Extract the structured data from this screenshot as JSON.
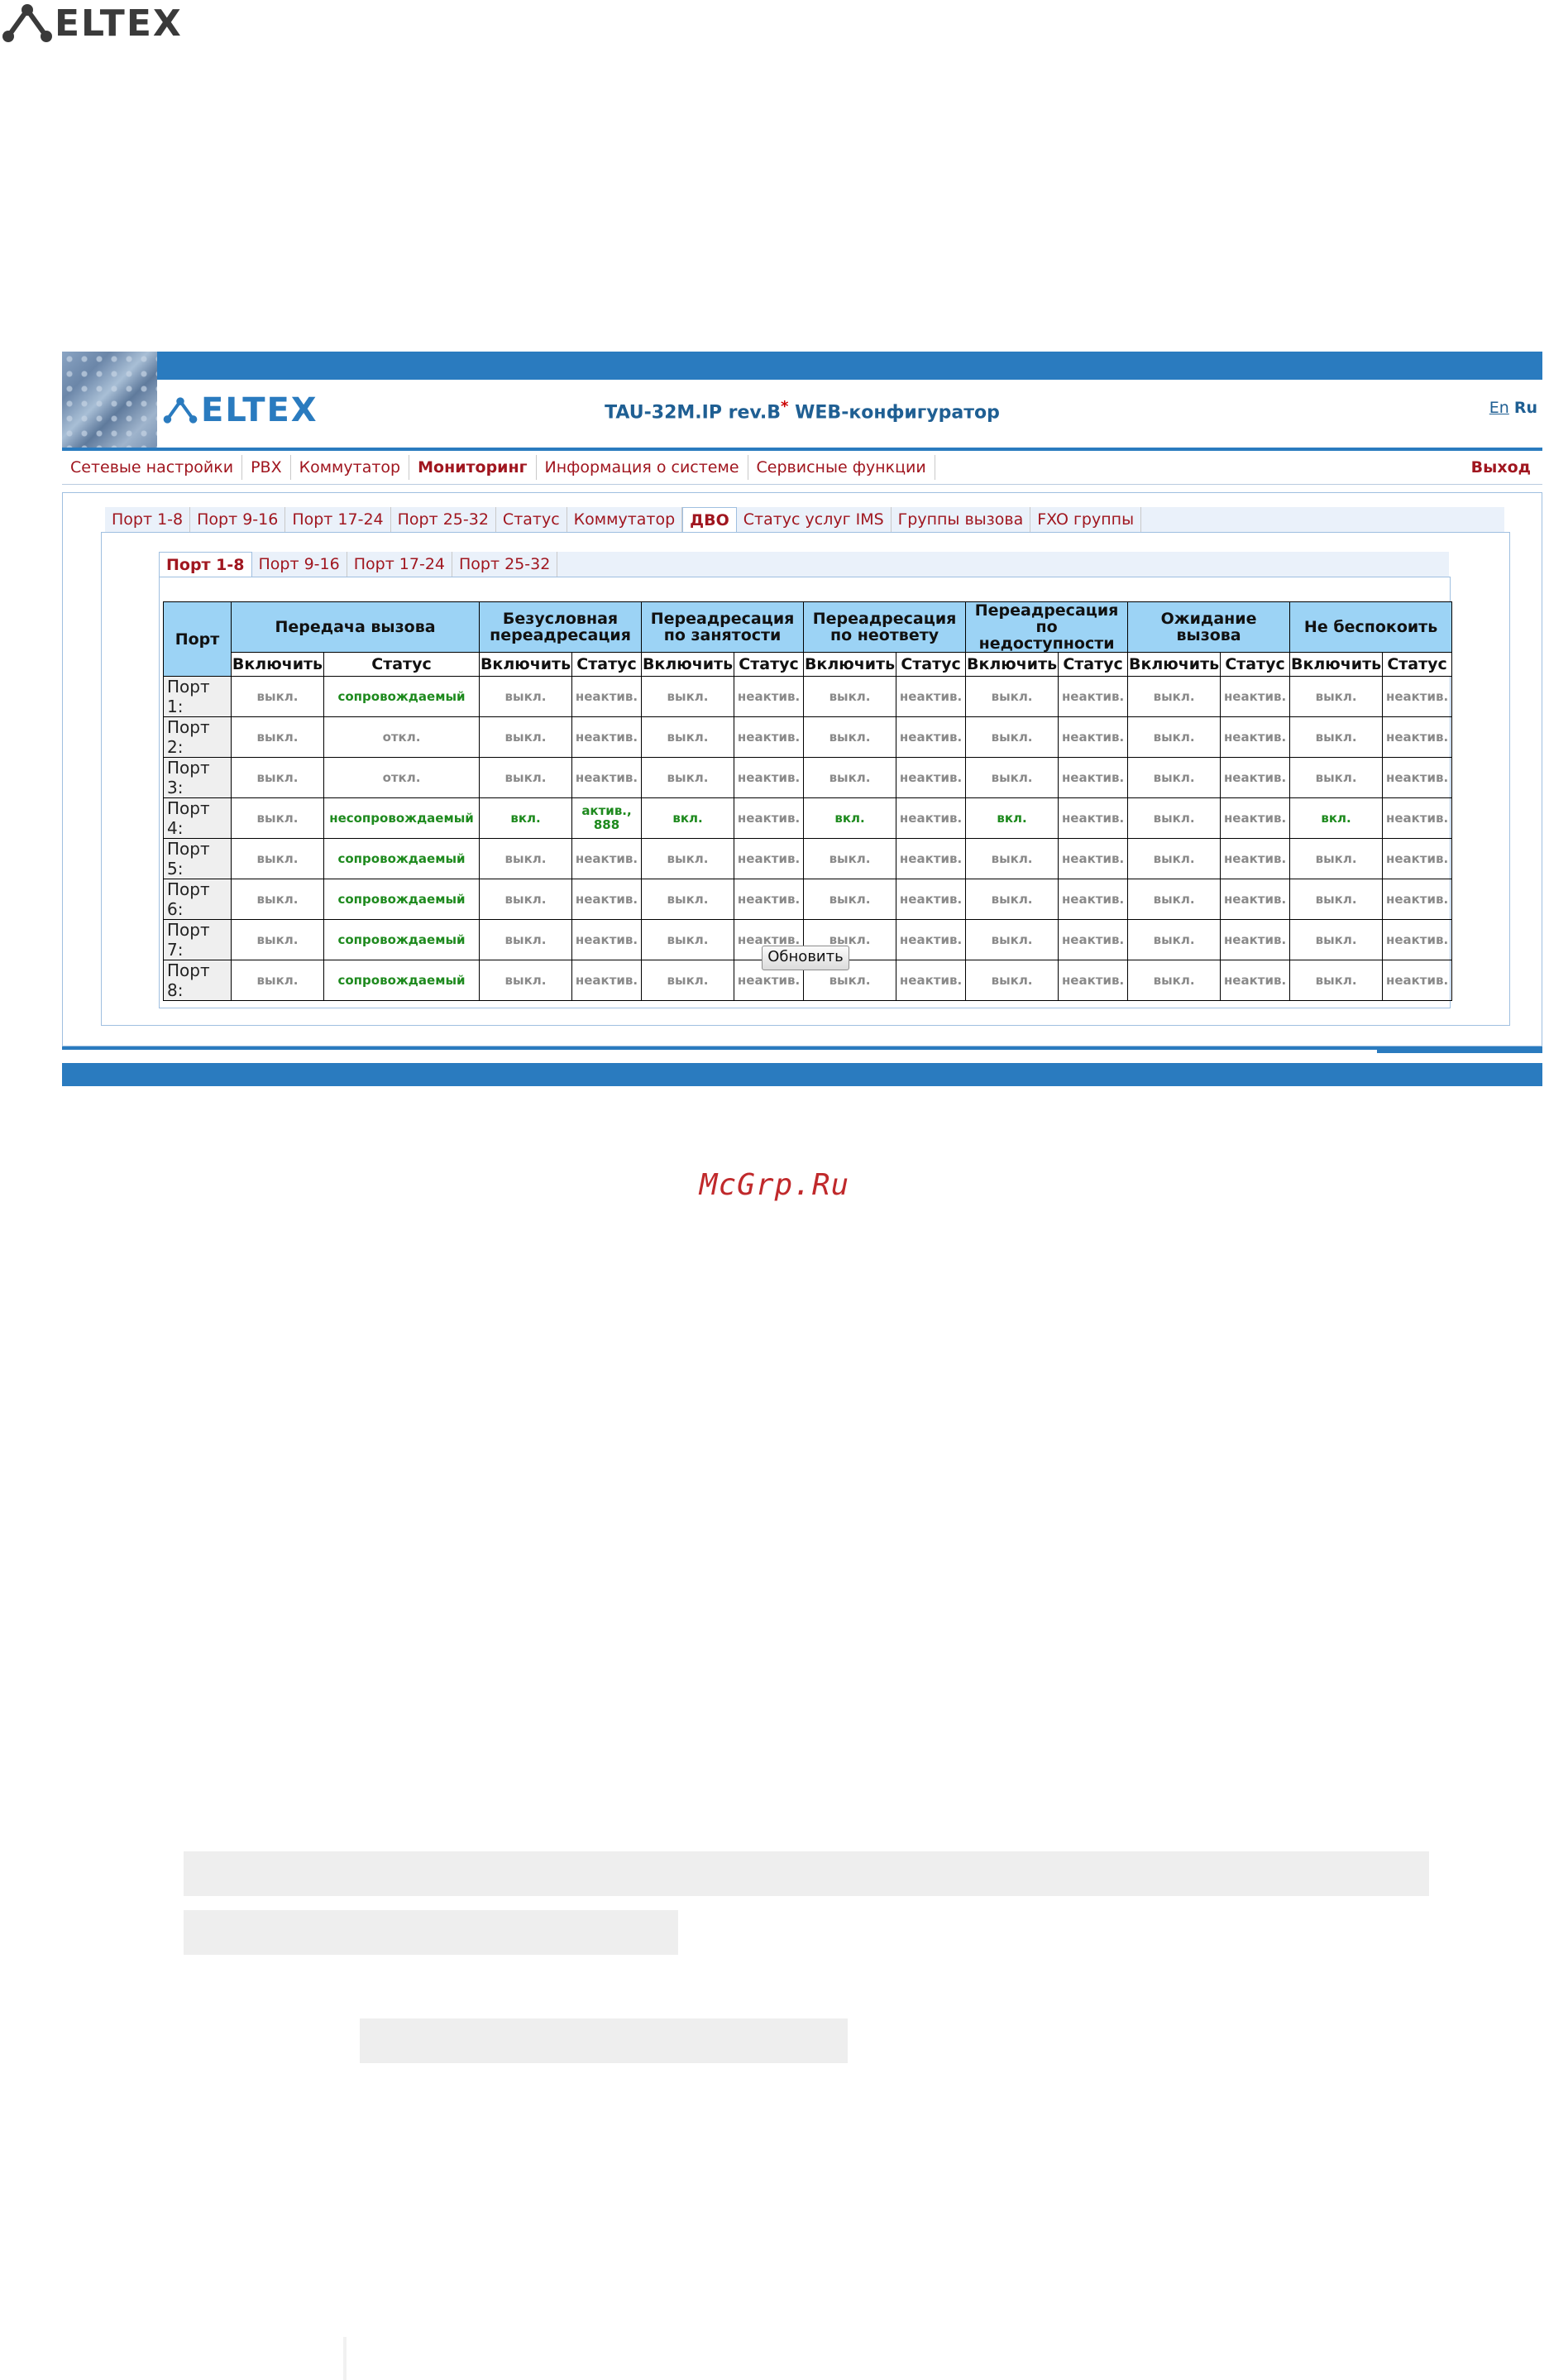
{
  "page_logo": {
    "text": "ELTEX"
  },
  "app": {
    "logo_text": "ELTEX",
    "title_main": "TAU-32M.IP rev.B",
    "title_star": "*",
    "title_suffix": " WEB-конфигуратор",
    "lang_en": "En",
    "lang_ru": "Ru"
  },
  "main_menu": {
    "items": [
      "Сетевые настройки",
      "PBX",
      "Коммутатор",
      "Мониторинг",
      "Информация о системе",
      "Сервисные функции"
    ],
    "active": "Мониторинг",
    "logout": "Выход"
  },
  "monitor_tabs": {
    "items": [
      "Порт 1-8",
      "Порт 9-16",
      "Порт 17-24",
      "Порт 25-32",
      "Статус",
      "Коммутатор",
      "ДВО",
      "Статус услуг IMS",
      "Группы вызова",
      "FXO группы"
    ],
    "active": "ДВО"
  },
  "port_tabs": {
    "items": [
      "Порт 1-8",
      "Порт 9-16",
      "Порт 17-24",
      "Порт 25-32"
    ],
    "active": "Порт 1-8"
  },
  "table": {
    "port_header": "Порт",
    "groups": [
      "Передача вызова",
      "Безусловная переадресация",
      "Переадресация по занятости",
      "Переадресация по неответу",
      "Переадресация по недоступности",
      "Ожидание вызова",
      "Не беспокоить"
    ],
    "group_lines": [
      [
        "Передача вызова"
      ],
      [
        "Безусловная",
        "переадресация"
      ],
      [
        "Переадресация",
        "по занятости"
      ],
      [
        "Переадресация",
        "по неответу"
      ],
      [
        "Переадресация",
        "по недоступности"
      ],
      [
        "Ожидание",
        "вызова"
      ],
      [
        "Не беспокоить"
      ]
    ],
    "sub_enable": "Включить",
    "sub_status": "Статус",
    "rows": [
      {
        "port": "Порт 1:",
        "cells": [
          "выкл.",
          "сопровождаемый",
          "выкл.",
          "неактив.",
          "выкл.",
          "неактив.",
          "выкл.",
          "неактив.",
          "выкл.",
          "неактив.",
          "выкл.",
          "неактив.",
          "выкл.",
          "неактив."
        ]
      },
      {
        "port": "Порт 2:",
        "cells": [
          "выкл.",
          "откл.",
          "выкл.",
          "неактив.",
          "выкл.",
          "неактив.",
          "выкл.",
          "неактив.",
          "выкл.",
          "неактив.",
          "выкл.",
          "неактив.",
          "выкл.",
          "неактив."
        ]
      },
      {
        "port": "Порт 3:",
        "cells": [
          "выкл.",
          "откл.",
          "выкл.",
          "неактив.",
          "выкл.",
          "неактив.",
          "выкл.",
          "неактив.",
          "выкл.",
          "неактив.",
          "выкл.",
          "неактив.",
          "выкл.",
          "неактив."
        ]
      },
      {
        "port": "Порт 4:",
        "cells": [
          "выкл.",
          "несопровождаемый",
          "вкл.",
          "актив., 888",
          "вкл.",
          "неактив.",
          "вкл.",
          "неактив.",
          "вкл.",
          "неактив.",
          "выкл.",
          "неактив.",
          "вкл.",
          "неактив."
        ]
      },
      {
        "port": "Порт 5:",
        "cells": [
          "выкл.",
          "сопровождаемый",
          "выкл.",
          "неактив.",
          "выкл.",
          "неактив.",
          "выкл.",
          "неактив.",
          "выкл.",
          "неактив.",
          "выкл.",
          "неактив.",
          "выкл.",
          "неактив."
        ]
      },
      {
        "port": "Порт 6:",
        "cells": [
          "выкл.",
          "сопровождаемый",
          "выкл.",
          "неактив.",
          "выкл.",
          "неактив.",
          "выкл.",
          "неактив.",
          "выкл.",
          "неактив.",
          "выкл.",
          "неактив.",
          "выкл.",
          "неактив."
        ]
      },
      {
        "port": "Порт 7:",
        "cells": [
          "выкл.",
          "сопровождаемый",
          "выкл.",
          "неактив.",
          "выкл.",
          "неактив.",
          "выкл.",
          "неактив.",
          "выкл.",
          "неактив.",
          "выкл.",
          "неактив.",
          "выкл.",
          "неактив."
        ]
      },
      {
        "port": "Порт 8:",
        "cells": [
          "выкл.",
          "сопровождаемый",
          "выкл.",
          "неактив.",
          "выкл.",
          "неактив.",
          "выкл.",
          "неактив.",
          "выкл.",
          "неактив.",
          "выкл.",
          "неактив.",
          "выкл.",
          "неактив."
        ]
      }
    ],
    "active_values": [
      "сопровождаемый",
      "несопровождаемый",
      "вкл.",
      "актив., 888"
    ]
  },
  "refresh_button": "Обновить",
  "watermark": "McGrp.Ru",
  "colors": {
    "accent_blue": "#2a7bbf",
    "menu_red": "#a0161f",
    "table_header": "#9cd3f5",
    "active_green": "#1e8a1e"
  }
}
